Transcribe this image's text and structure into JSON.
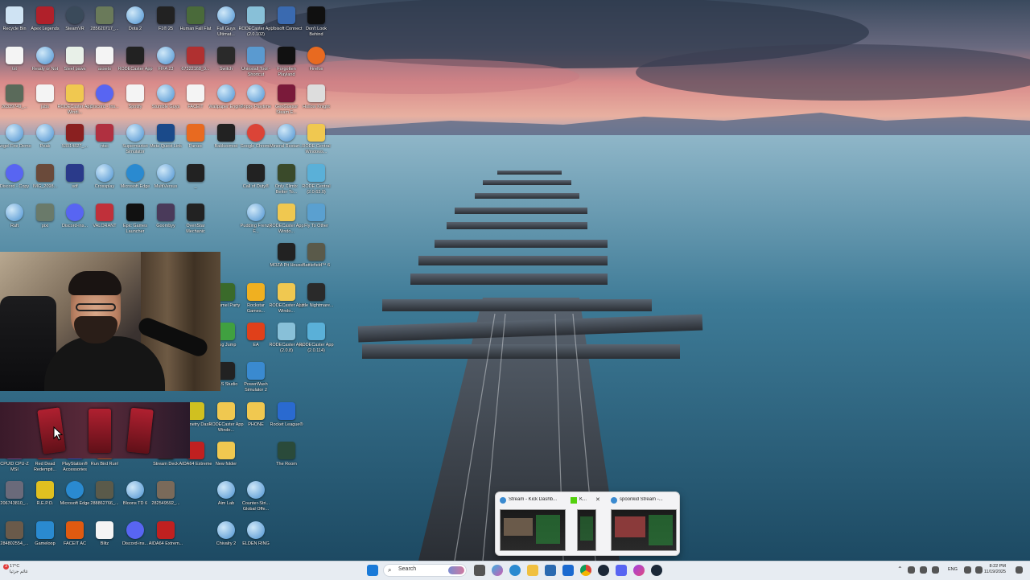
{
  "colors": {
    "taskbar": "#e7ecf2",
    "label": "#ffffff"
  },
  "desktop_icons": [
    {
      "label": "Recycle Bin",
      "icon": "recycle-bin-icon",
      "color": "#cfe3f3"
    },
    {
      "label": "Apex Legends",
      "icon": "apex-icon",
      "color": "#b0202a"
    },
    {
      "label": "SteamVR",
      "icon": "steamvr-icon",
      "color": "#3a4a5a"
    },
    {
      "label": "285620717_...",
      "icon": "image-icon",
      "color": "#6a7a5a"
    },
    {
      "label": "Dota 2",
      "icon": "globe-icon",
      "color": "#79b3e0"
    },
    {
      "label": "F1® 25",
      "icon": "f1-icon",
      "color": "#222222"
    },
    {
      "label": "Human Fall Flat",
      "icon": "hff-icon",
      "color": "#4a6a3a"
    },
    {
      "label": "Fall Guys Ultimat...",
      "icon": "globe-icon",
      "color": "#79b3e0"
    },
    {
      "label": "RODECaster App (2.0.102)",
      "icon": "rode-icon",
      "color": "#88c0d8"
    },
    {
      "label": "Ubisoft Connect",
      "icon": "ubisoft-icon",
      "color": "#3a6ab0"
    },
    {
      "label": "Don't Look Behind",
      "icon": "game-icon",
      "color": "#101010"
    },
    {
      "label": "txt",
      "icon": "file-icon",
      "color": "#f4f4f4"
    },
    {
      "label": "Ready or Not",
      "icon": "globe-icon",
      "color": "#79b3e0"
    },
    {
      "label": "Steel paws",
      "icon": "file-icon",
      "color": "#e8f0e8"
    },
    {
      "label": "assets",
      "icon": "file-icon",
      "color": "#f4f4f4"
    },
    {
      "label": "RODECaster App",
      "icon": "rode-icon",
      "color": "#222222"
    },
    {
      "label": "FIFA 23",
      "icon": "globe-icon",
      "color": "#79b3e0"
    },
    {
      "label": "67322168_9...",
      "icon": "image-icon",
      "color": "#b03030"
    },
    {
      "label": "Switch",
      "icon": "switch-icon",
      "color": "#2a2a2a"
    },
    {
      "label": "Uninstall Tool - Shortcut",
      "icon": "uninstall-icon",
      "color": "#5a9ad0"
    },
    {
      "label": "Forgotten Playland",
      "icon": "epic-icon",
      "color": "#111111"
    },
    {
      "label": "Firefox",
      "icon": "firefox-icon",
      "color": "#e86a20"
    },
    {
      "label": "26339749_...",
      "icon": "image-icon",
      "color": "#5a6a5a"
    },
    {
      "label": "jabs",
      "icon": "file-icon",
      "color": "#f4f4f4"
    },
    {
      "label": "RODECaster App Windi...",
      "icon": "folder-icon",
      "color": "#f0c850"
    },
    {
      "label": "Discord - Ins...",
      "icon": "discord-icon",
      "color": "#5865f2"
    },
    {
      "label": "Spotify",
      "icon": "file-icon",
      "color": "#f4f4f4"
    },
    {
      "label": "Stumble Guys",
      "icon": "globe-icon",
      "color": "#79b3e0"
    },
    {
      "label": "FACEIT",
      "icon": "file-icon",
      "color": "#f4f4f4"
    },
    {
      "label": "Wallpaper Engine",
      "icon": "globe-icon",
      "color": "#79b3e0"
    },
    {
      "label": "Poppy Playtime",
      "icon": "globe-icon",
      "color": "#79b3e0"
    },
    {
      "label": "GeoGuessr Steam E...",
      "icon": "geoguessr-icon",
      "color": "#7a1a3a"
    },
    {
      "label": "Hollow Knight",
      "icon": "hollow-knight-icon",
      "color": "#dddddd"
    },
    {
      "label": "Angel Fire Demo",
      "icon": "globe-icon",
      "color": "#79b3e0"
    },
    {
      "label": "Peak",
      "icon": "globe-icon",
      "color": "#79b3e0"
    },
    {
      "label": "53914827_...",
      "icon": "image-icon",
      "color": "#8a2020"
    },
    {
      "label": "ntsc",
      "icon": "file-icon",
      "color": "#b03040"
    },
    {
      "label": "Supermarket Simulator",
      "icon": "globe-icon",
      "color": "#79b3e0"
    },
    {
      "label": "Meta Quest Link",
      "icon": "meta-icon",
      "color": "#1a4a8a"
    },
    {
      "label": "Parsec",
      "icon": "parsec-icon",
      "color": "#e86a20"
    },
    {
      "label": "Bakkesmod",
      "icon": "bakkesmod-icon",
      "color": "#222222"
    },
    {
      "label": "Google Chrome",
      "icon": "chrome-icon",
      "color": "#db4437"
    },
    {
      "label": "Mineral Restart...",
      "icon": "globe-icon",
      "color": "#79b3e0"
    },
    {
      "label": "RODE Central Windows...",
      "icon": "folder-icon",
      "color": "#f0c850"
    },
    {
      "label": "Discord - Copy",
      "icon": "discord-icon",
      "color": "#5865f2"
    },
    {
      "label": "IMG_2098...",
      "icon": "image-icon",
      "color": "#6a4a3a"
    },
    {
      "label": "sdf",
      "icon": "file-icon",
      "color": "#2a3a8a"
    },
    {
      "label": "Crossplay",
      "icon": "globe-icon",
      "color": "#79b3e0"
    },
    {
      "label": "Microsoft Edge",
      "icon": "edge-icon",
      "color": "#2a8ad0"
    },
    {
      "label": "MultiVersus",
      "icon": "globe-icon",
      "color": "#79b3e0"
    },
    {
      "label": "_",
      "icon": "file-icon",
      "color": "#222222"
    },
    {
      "label": "Call of Duty®",
      "icon": "cod-icon",
      "color": "#222222"
    },
    {
      "label": "Only Climb: Better To...",
      "icon": "game-icon",
      "color": "#3a4a2a"
    },
    {
      "label": "RODE Central (2.0.63.0)",
      "icon": "rode-icon",
      "color": "#5ab0d8"
    },
    {
      "label": "Raft",
      "icon": "globe-icon",
      "color": "#79b3e0"
    },
    {
      "label": "pixi",
      "icon": "image-icon",
      "color": "#6a7a6a"
    },
    {
      "label": "Discord-ins...",
      "icon": "discord-icon",
      "color": "#5865f2"
    },
    {
      "label": "VALORANT",
      "icon": "valorant-icon",
      "color": "#c0303a"
    },
    {
      "label": "Epic Games Launcher",
      "icon": "epic-icon",
      "color": "#111111"
    },
    {
      "label": "Goombyy",
      "icon": "image-icon",
      "color": "#4a3a5a"
    },
    {
      "label": "OvenStar Mechanic",
      "icon": "obs-icon",
      "color": "#222222"
    },
    {
      "label": "Pudding Frenzy F...",
      "icon": "globe-icon",
      "color": "#79b3e0"
    },
    {
      "label": "RODECaster App Windo...",
      "icon": "folder-icon",
      "color": "#f0c850"
    },
    {
      "label": "Fly To Other",
      "icon": "image-icon",
      "color": "#5aa0d0"
    },
    {
      "label": "MOZA Pit House",
      "icon": "moza-icon",
      "color": "#222222"
    },
    {
      "label": "Battlefield™ 6",
      "icon": "image-icon",
      "color": "#5a5a4a"
    },
    {
      "label": "Pummel Party",
      "icon": "game-icon",
      "color": "#3a6a2a"
    },
    {
      "label": "Rockstar Games...",
      "icon": "rockstar-icon",
      "color": "#f0b020"
    },
    {
      "label": "RODECaster App Windo...",
      "icon": "folder-icon",
      "color": "#f0c850"
    },
    {
      "label": "Little Nightmare...",
      "icon": "game-icon",
      "color": "#2a2a2a"
    },
    {
      "label": "Bug Jump",
      "icon": "game-icon",
      "color": "#40a040"
    },
    {
      "label": "EA",
      "icon": "ea-icon",
      "color": "#e0401a"
    },
    {
      "label": "RODECaster App (2.0.8)",
      "icon": "rode-icon",
      "color": "#88c0d8"
    },
    {
      "label": "RODECaster App (2.0.114)",
      "icon": "rode-icon",
      "color": "#5ab0d8"
    },
    {
      "label": "OBS Studio",
      "icon": "obs-icon",
      "color": "#222222"
    },
    {
      "label": "PowerWash Simulator 2",
      "icon": "powerwash-icon",
      "color": "#3a8ad0"
    },
    {
      "label": "Geometry Dash",
      "icon": "geometry-dash-icon",
      "color": "#d0c020"
    },
    {
      "label": "RODECaster App Windo...",
      "icon": "folder-icon",
      "color": "#f0c850"
    },
    {
      "label": "PHONE",
      "icon": "folder-icon",
      "color": "#f0c850"
    },
    {
      "label": "Rocket League®",
      "icon": "rocket-league-icon",
      "color": "#2a6ad0"
    },
    {
      "label": "CPUID CPU-Z MSI",
      "icon": "cpuz-icon",
      "color": "#6a4a8a"
    },
    {
      "label": "Red Dead Redempti...",
      "icon": "game-icon",
      "color": "#a02020"
    },
    {
      "label": "PlayStation® Accessories",
      "icon": "playstation-icon",
      "color": "#2a4ab0"
    },
    {
      "label": "Run Bird Run!",
      "icon": "game-icon",
      "color": "#b05020"
    },
    {
      "label": "Stream Deck",
      "icon": "stream-deck-icon",
      "color": "#222222"
    },
    {
      "label": "AIDA64 Extreme",
      "icon": "aida64-icon",
      "color": "#c02020"
    },
    {
      "label": "New folder",
      "icon": "folder-icon",
      "color": "#f0c850"
    },
    {
      "label": "The Room",
      "icon": "game-icon",
      "color": "#2a4a3a"
    },
    {
      "label": "206743810_...",
      "icon": "image-icon",
      "color": "#6a6a7a"
    },
    {
      "label": "R.E.P.O.",
      "icon": "repo-icon",
      "color": "#e0c020"
    },
    {
      "label": "Microsoft Edge",
      "icon": "edge-icon",
      "color": "#2a8ad0"
    },
    {
      "label": "288862766_...",
      "icon": "image-icon",
      "color": "#5a5a4a"
    },
    {
      "label": "Bloons TD 6",
      "icon": "globe-icon",
      "color": "#79b3e0"
    },
    {
      "label": "282549592_...",
      "icon": "image-icon",
      "color": "#7a6a5a"
    },
    {
      "label": "Aim Lab",
      "icon": "globe-icon",
      "color": "#79b3e0"
    },
    {
      "label": "Counter-Stri... Global Offe...",
      "icon": "globe-icon",
      "color": "#79b3e0"
    },
    {
      "label": "284802554_...",
      "icon": "image-icon",
      "color": "#6a5a4a"
    },
    {
      "label": "Gameloop",
      "icon": "gameloop-icon",
      "color": "#2a8ad0"
    },
    {
      "label": "FACEIT AC",
      "icon": "faceit-icon",
      "color": "#e05a10"
    },
    {
      "label": "Blitz",
      "icon": "file-icon",
      "color": "#f4f4f4"
    },
    {
      "label": "Discord-ins...",
      "icon": "discord-icon",
      "color": "#5865f2"
    },
    {
      "label": "AIDA64 Extrem...",
      "icon": "aida64-icon",
      "color": "#c02020"
    },
    {
      "label": "Chivalry 2",
      "icon": "globe-icon",
      "color": "#79b3e0"
    },
    {
      "label": "ELDEN RING",
      "icon": "globe-icon",
      "color": "#79b3e0"
    }
  ],
  "taskbar": {
    "weather_temp": "17°C",
    "weather_text": "غائم جزئيا",
    "search_placeholder": "Search",
    "language": "ENG",
    "time": "8:22 PM",
    "date": "11/19/2025",
    "notification_count": "3"
  },
  "taskbar_icons": [
    "start-icon",
    "search-icon",
    "widgets-icon",
    "file-explorer-icon",
    "copilot-icon",
    "edge-icon",
    "folder-icon",
    "store-icon",
    "outlook-icon",
    "chrome-icon",
    "steam-icon",
    "discord-icon",
    "teams-icon",
    "messenger-icon",
    "steam-icon"
  ],
  "preview_popup": {
    "windows": [
      {
        "title": "Stream - Kick Dashb..."
      },
      {
        "title": "K..."
      },
      {
        "title": "spoonkid Stream -..."
      }
    ]
  }
}
